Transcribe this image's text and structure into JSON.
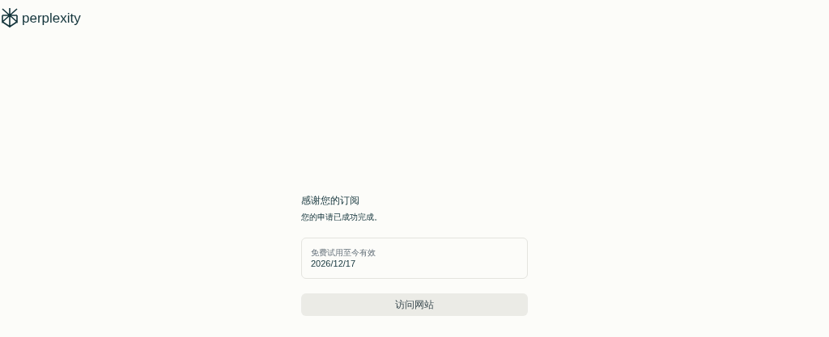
{
  "logo": {
    "text": "perplexity"
  },
  "title": "感谢您的订阅",
  "subtitle": "您的申请已成功完成。",
  "trial_card": {
    "label": "免费试用至今有效",
    "value": "2026/12/17"
  },
  "button": {
    "label": "访问网站"
  }
}
